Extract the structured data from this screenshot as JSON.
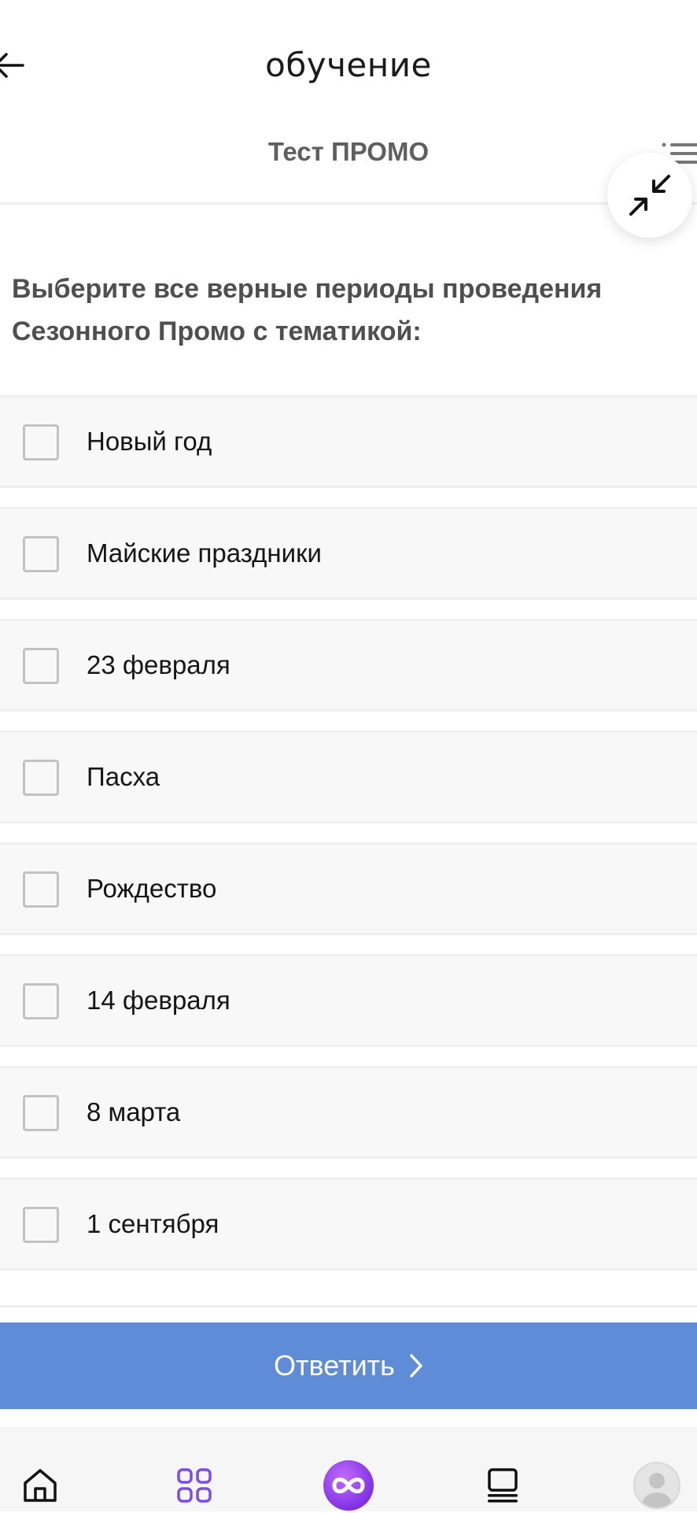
{
  "header": {
    "title": "обучение",
    "test_title": "Тест ПРОМО"
  },
  "question": {
    "text": "Выберите все верные периоды проведения Сезонного Промо с тематикой:"
  },
  "options": [
    {
      "label": "Новый год",
      "checked": false
    },
    {
      "label": "Майские праздники",
      "checked": false
    },
    {
      "label": "23 февраля",
      "checked": false
    },
    {
      "label": "Пасха",
      "checked": false
    },
    {
      "label": "Рождество",
      "checked": false
    },
    {
      "label": "14 февраля",
      "checked": false
    },
    {
      "label": "8 марта",
      "checked": false
    },
    {
      "label": "1 сентября",
      "checked": false
    }
  ],
  "answer_button": {
    "label": "Ответить"
  },
  "bottom_nav": {
    "items": [
      {
        "icon": "home-icon"
      },
      {
        "icon": "apps-grid-icon"
      },
      {
        "icon": "infinity-icon"
      },
      {
        "icon": "courses-icon"
      },
      {
        "icon": "profile-avatar"
      }
    ]
  },
  "colors": {
    "accent_button": "#5e8cd6",
    "nav_purple": "#7a4df0",
    "question_text": "#4f4f4f"
  }
}
